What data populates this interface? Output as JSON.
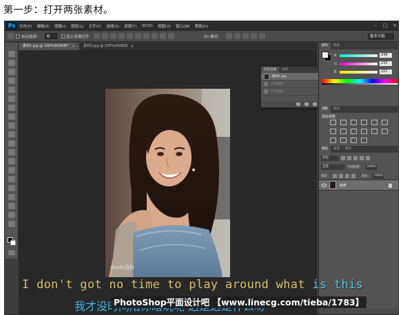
{
  "caption": "第一步：打开两张素材。",
  "menubar": {
    "logo": "Ps",
    "items": [
      "文件(F)",
      "编辑(E)",
      "图像(I)",
      "图层(L)",
      "文字(Y)",
      "选择(S)",
      "滤镜(T)",
      "3D(D)",
      "视图(V)",
      "窗口(W)",
      "帮助(H)"
    ],
    "window_buttons": [
      "–",
      "□",
      "×"
    ]
  },
  "options_bar": {
    "auto_select_label": "自动选择：",
    "auto_select_value": "组",
    "transform_controls_label": "显示变换控件",
    "mode_3d_label": "3D 模式：",
    "workspace": "基本功能"
  },
  "document_tabs": [
    {
      "label": "素材1.jpg @ 100%(RGB/8)*",
      "active": true
    },
    {
      "label": "素材2.jpg @ 100%(RGB/8)",
      "active": false
    }
  ],
  "history_panel": {
    "tabs": [
      "历史记录",
      "动作"
    ],
    "snapshot": "素材1.jpg",
    "states": [
      "打开素材",
      "打开素材",
      "打开素材"
    ]
  },
  "color_panel": {
    "tabs": [
      "颜色",
      "色板"
    ],
    "channels": [
      {
        "label": "R",
        "value": "246",
        "gradient": "linear-gradient(to right, #00f2e3, #fff2e3)"
      },
      {
        "label": "G",
        "value": "235",
        "gradient": "linear-gradient(to right, #f600e3, #f6ffe3)"
      },
      {
        "label": "B",
        "value": "222",
        "gradient": "linear-gradient(to right, #f6f200, #f6f2ff)"
      }
    ],
    "foreground": "#f6ebde",
    "background": "#000000"
  },
  "adjustments_panel": {
    "tabs": [
      "调整",
      "样式"
    ],
    "title": "添加调整"
  },
  "layers_panel": {
    "tabs": [
      "图层",
      "通道",
      "路径"
    ],
    "filter_label": "类型",
    "blend_mode": "正常",
    "opacity_label": "不透明度：",
    "opacity_value": "100%",
    "lock_label": "锁定：",
    "fill_label": "填充：",
    "fill_value": "100%",
    "layer_name": "背景"
  },
  "photo": {
    "watermark": "Baidu百科"
  },
  "subtitles": {
    "english_main": "I don't got no time to play around what ",
    "english_highlight": "is this",
    "chinese": "我才没时间陪你瞎玩呢 这是这是什么呀",
    "banner": "PhotoShop平面设计吧 【www.linecg.com/tieba/1783】"
  }
}
